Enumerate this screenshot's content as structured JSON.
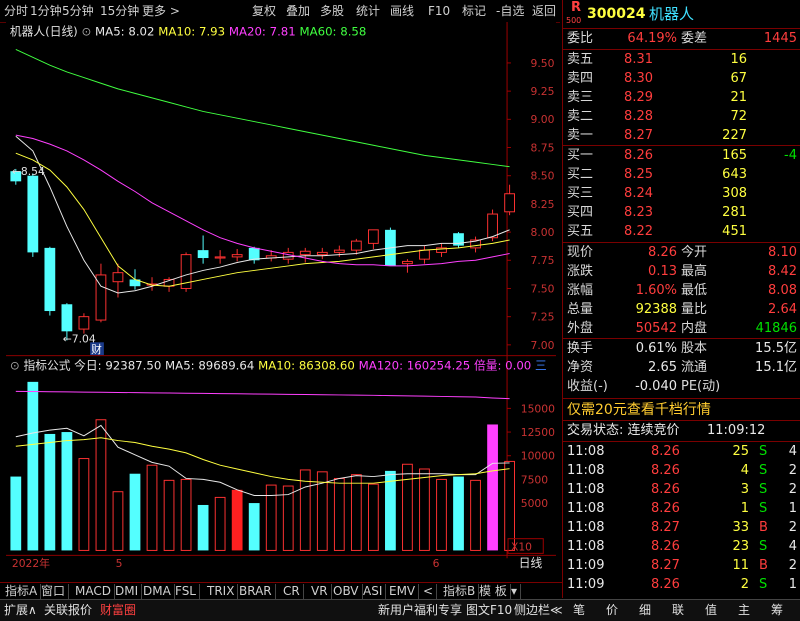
{
  "menu": [
    "分时",
    "1分钟",
    "5分钟",
    "15分钟",
    "更多 >",
    "复权",
    "叠加",
    "多股",
    "统计",
    "画线",
    "F10",
    "标记",
    "-自选",
    "返回"
  ],
  "chart": {
    "title": "机器人(日线)",
    "ma_legend": [
      {
        "label": "MA5: 8.02",
        "color": "#e8e8e8"
      },
      {
        "label": "MA10: 7.93",
        "color": "#ffff40"
      },
      {
        "label": "MA20: 7.81",
        "color": "#ff40ff"
      },
      {
        "label": "MA60: 8.58",
        "color": "#40ff40"
      }
    ],
    "y_ticks": [
      "9.50",
      "9.25",
      "9.00",
      "8.75",
      "8.50",
      "8.25",
      "8.00",
      "7.75",
      "7.50",
      "7.25",
      "7.00"
    ],
    "high_label": "8.54",
    "low_label": "7.04",
    "cai_badge": "财",
    "vol_legend": [
      {
        "label": "指标公式",
        "color": "#e0e0e0"
      },
      {
        "label": "今日: 92387.50",
        "color": "#e8e8e8"
      },
      {
        "label": "MA5: 89689.64",
        "color": "#e8e8e8"
      },
      {
        "label": "MA10: 86308.60",
        "color": "#ffff40"
      },
      {
        "label": "MA120: 160254.25",
        "color": "#ff40ff"
      },
      {
        "label": "倍量: 0.00",
        "color": "#ff40ff"
      },
      {
        "label": "三",
        "color": "#4080ff"
      }
    ],
    "vol_ticks": [
      "15000",
      "12500",
      "10000",
      "7500",
      "5000"
    ],
    "vol_unit": "X10",
    "x_labels": [
      "2022年",
      "5",
      "6"
    ],
    "period": "日线"
  },
  "chart_data": {
    "type": "candlestick",
    "title": "机器人(日线)",
    "price_ylim": [
      6.93,
      9.62
    ],
    "volume_ylim": [
      0,
      18600
    ],
    "candles": [
      {
        "o": 8.54,
        "h": 8.56,
        "l": 8.42,
        "c": 8.45
      },
      {
        "o": 8.5,
        "h": 8.52,
        "l": 7.78,
        "c": 7.82
      },
      {
        "o": 7.86,
        "h": 7.87,
        "l": 7.26,
        "c": 7.3
      },
      {
        "o": 7.36,
        "h": 7.37,
        "l": 7.04,
        "c": 7.12
      },
      {
        "o": 7.14,
        "h": 7.28,
        "l": 7.1,
        "c": 7.25
      },
      {
        "o": 7.22,
        "h": 7.72,
        "l": 7.2,
        "c": 7.62
      },
      {
        "o": 7.56,
        "h": 7.72,
        "l": 7.42,
        "c": 7.64
      },
      {
        "o": 7.58,
        "h": 7.67,
        "l": 7.49,
        "c": 7.52
      },
      {
        "o": 7.53,
        "h": 7.6,
        "l": 7.48,
        "c": 7.54
      },
      {
        "o": 7.52,
        "h": 7.6,
        "l": 7.47,
        "c": 7.58
      },
      {
        "o": 7.5,
        "h": 7.82,
        "l": 7.47,
        "c": 7.8
      },
      {
        "o": 7.84,
        "h": 7.97,
        "l": 7.72,
        "c": 7.77
      },
      {
        "o": 7.77,
        "h": 7.84,
        "l": 7.72,
        "c": 7.78
      },
      {
        "o": 7.78,
        "h": 7.85,
        "l": 7.74,
        "c": 7.8
      },
      {
        "o": 7.86,
        "h": 7.87,
        "l": 7.72,
        "c": 7.75
      },
      {
        "o": 7.77,
        "h": 7.84,
        "l": 7.74,
        "c": 7.79
      },
      {
        "o": 7.76,
        "h": 7.86,
        "l": 7.72,
        "c": 7.82
      },
      {
        "o": 7.8,
        "h": 7.86,
        "l": 7.73,
        "c": 7.83
      },
      {
        "o": 7.8,
        "h": 7.86,
        "l": 7.76,
        "c": 7.82
      },
      {
        "o": 7.82,
        "h": 7.88,
        "l": 7.78,
        "c": 7.84
      },
      {
        "o": 7.84,
        "h": 7.94,
        "l": 7.8,
        "c": 7.92
      },
      {
        "o": 7.9,
        "h": 8.02,
        "l": 7.85,
        "c": 8.02
      },
      {
        "o": 8.02,
        "h": 8.04,
        "l": 7.7,
        "c": 7.7
      },
      {
        "o": 7.72,
        "h": 7.76,
        "l": 7.64,
        "c": 7.74
      },
      {
        "o": 7.76,
        "h": 7.88,
        "l": 7.72,
        "c": 7.84
      },
      {
        "o": 7.82,
        "h": 7.9,
        "l": 7.78,
        "c": 7.86
      },
      {
        "o": 7.99,
        "h": 8.0,
        "l": 7.86,
        "c": 7.88
      },
      {
        "o": 7.86,
        "h": 7.96,
        "l": 7.82,
        "c": 7.93
      },
      {
        "o": 7.95,
        "h": 8.2,
        "l": 7.92,
        "c": 8.16
      },
      {
        "o": 8.18,
        "h": 8.42,
        "l": 8.15,
        "c": 8.34
      }
    ],
    "ma": [
      {
        "name": "MA5",
        "color": "#e8e8e8",
        "values": [
          8.85,
          8.72,
          8.4,
          8.05,
          7.75,
          7.52,
          7.46,
          7.48,
          7.52,
          7.57,
          7.62,
          7.66,
          7.69,
          7.73,
          7.76,
          7.77,
          7.78,
          7.79,
          7.79,
          7.8,
          7.81,
          7.84,
          7.86,
          7.88,
          7.88,
          7.9,
          7.9,
          7.92,
          7.96,
          8.02
        ]
      },
      {
        "name": "MA10",
        "color": "#ffff40",
        "values": [
          8.7,
          8.64,
          8.55,
          8.4,
          8.2,
          7.95,
          7.7,
          7.58,
          7.53,
          7.52,
          7.55,
          7.58,
          7.61,
          7.64,
          7.66,
          7.68,
          7.7,
          7.72,
          7.73,
          7.74,
          7.76,
          7.78,
          7.8,
          7.82,
          7.84,
          7.85,
          7.86,
          7.88,
          7.9,
          7.93
        ]
      },
      {
        "name": "MA20",
        "color": "#ff40ff",
        "values": [
          8.86,
          8.83,
          8.78,
          8.72,
          8.64,
          8.55,
          8.45,
          8.36,
          8.26,
          8.18,
          8.1,
          8.02,
          7.95,
          7.9,
          7.86,
          7.83,
          7.8,
          7.77,
          7.74,
          7.72,
          7.71,
          7.71,
          7.7,
          7.7,
          7.71,
          7.72,
          7.74,
          7.75,
          7.78,
          7.81
        ]
      },
      {
        "name": "MA60",
        "color": "#40ff40",
        "values": [
          9.62,
          9.55,
          9.48,
          9.42,
          9.37,
          9.32,
          9.27,
          9.23,
          9.19,
          9.15,
          9.11,
          9.07,
          9.04,
          9.01,
          8.98,
          8.95,
          8.92,
          8.89,
          8.86,
          8.83,
          8.8,
          8.77,
          8.74,
          8.71,
          8.68,
          8.66,
          8.64,
          8.62,
          8.6,
          8.58
        ]
      }
    ],
    "volume": [
      7800,
      17800,
      12300,
      12500,
      9700,
      13800,
      6200,
      8100,
      9000,
      7400,
      7500,
      4800,
      5600,
      6400,
      5000,
      6900,
      6800,
      8500,
      8300,
      7600,
      8000,
      7000,
      8400,
      9100,
      8600,
      7500,
      7800,
      7400,
      13300,
      9400
    ],
    "volume_ma": [
      {
        "name": "MA5",
        "color": "#e8e8e8",
        "values": [
          12000,
          12400,
          12700,
          12900,
          12100,
          13200,
          10900,
          10100,
          9300,
          8900,
          7600,
          7500,
          7200,
          6400,
          5800,
          5800,
          5900,
          6700,
          7100,
          7600,
          7900,
          7800,
          8000,
          8100,
          8100,
          8100,
          8000,
          8000,
          9200,
          9239
        ]
      },
      {
        "name": "MA10",
        "color": "#ffff40",
        "values": [
          11000,
          11200,
          11400,
          11600,
          11700,
          11900,
          11600,
          11400,
          11000,
          10700,
          10300,
          9600,
          9000,
          8600,
          8200,
          7800,
          7500,
          7300,
          7200,
          7100,
          7100,
          7100,
          7300,
          7500,
          7700,
          7900,
          8000,
          8100,
          8400,
          8631
        ]
      },
      {
        "name": "MA120",
        "color": "#ff40ff",
        "values": [
          16800,
          16780,
          16760,
          16740,
          16720,
          16700,
          16680,
          16660,
          16640,
          16620,
          16600,
          16580,
          16560,
          16540,
          16520,
          16500,
          16480,
          16460,
          16440,
          16420,
          16400,
          16380,
          16350,
          16320,
          16290,
          16260,
          16230,
          16200,
          16100,
          16025
        ]
      }
    ],
    "x_labels": [
      "2022年",
      "5",
      "6"
    ]
  },
  "quote": {
    "logo_top": "R",
    "logo_bottom": "500",
    "code": "300024",
    "name": "机器人",
    "weibi_label": "委比",
    "weibi_value": "64.19%",
    "weicha_label": "委差",
    "weicha_value": "1445",
    "asks": [
      {
        "label": "卖五",
        "price": "8.31",
        "vol": "16",
        "chg": ""
      },
      {
        "label": "卖四",
        "price": "8.30",
        "vol": "67",
        "chg": ""
      },
      {
        "label": "卖三",
        "price": "8.29",
        "vol": "21",
        "chg": ""
      },
      {
        "label": "卖二",
        "price": "8.28",
        "vol": "72",
        "chg": ""
      },
      {
        "label": "卖一",
        "price": "8.27",
        "vol": "227",
        "chg": ""
      }
    ],
    "bids": [
      {
        "label": "买一",
        "price": "8.26",
        "vol": "165",
        "chg": "-4"
      },
      {
        "label": "买二",
        "price": "8.25",
        "vol": "643",
        "chg": ""
      },
      {
        "label": "买三",
        "price": "8.24",
        "vol": "308",
        "chg": ""
      },
      {
        "label": "买四",
        "price": "8.23",
        "vol": "281",
        "chg": ""
      },
      {
        "label": "买五",
        "price": "8.22",
        "vol": "451",
        "chg": ""
      }
    ],
    "stats": [
      {
        "l1": "现价",
        "v1": "8.26",
        "c1": "red",
        "l2": "今开",
        "v2": "8.10",
        "c2": "red"
      },
      {
        "l1": "涨跌",
        "v1": "0.13",
        "c1": "red",
        "l2": "最高",
        "v2": "8.42",
        "c2": "red"
      },
      {
        "l1": "涨幅",
        "v1": "1.60%",
        "c1": "red",
        "l2": "最低",
        "v2": "8.08",
        "c2": "red"
      },
      {
        "l1": "总量",
        "v1": "92388",
        "c1": "yel",
        "l2": "量比",
        "v2": "2.64",
        "c2": "red"
      },
      {
        "l1": "外盘",
        "v1": "50542",
        "c1": "red",
        "l2": "内盘",
        "v2": "41846",
        "c2": "grn"
      }
    ],
    "fund": [
      {
        "l1": "换手",
        "v1": "0.61%",
        "l2": "股本",
        "v2": "15.5亿"
      },
      {
        "l1": "净资",
        "v1": "2.65",
        "l2": "流通",
        "v2": "15.1亿"
      },
      {
        "l1": "收益(-)",
        "v1": "-0.040",
        "l2": "PE(动)",
        "v2": ""
      }
    ],
    "promo": "仅需20元查看千档行情",
    "trade_status_label": "交易状态: 连续竞价",
    "trade_time": "11:09:12",
    "ticks": [
      {
        "t": "11:08",
        "p": "8.26",
        "v": "25",
        "s": "S",
        "n": "4"
      },
      {
        "t": "11:08",
        "p": "8.26",
        "v": "4",
        "s": "S",
        "n": "2"
      },
      {
        "t": "11:08",
        "p": "8.26",
        "v": "3",
        "s": "S",
        "n": "2"
      },
      {
        "t": "11:08",
        "p": "8.26",
        "v": "1",
        "s": "S",
        "n": "1"
      },
      {
        "t": "11:08",
        "p": "8.27",
        "v": "33",
        "s": "B",
        "n": "2"
      },
      {
        "t": "11:08",
        "p": "8.26",
        "v": "23",
        "s": "S",
        "n": "4"
      },
      {
        "t": "11:09",
        "p": "8.27",
        "v": "11",
        "s": "B",
        "n": "2"
      },
      {
        "t": "11:09",
        "p": "8.26",
        "v": "2",
        "s": "S",
        "n": "1"
      }
    ]
  },
  "tabs": [
    "指标A",
    "窗口",
    "MACD",
    "DMI",
    "DMA",
    "FSL",
    "TRIX",
    "BRAR",
    "CR",
    "VR",
    "OBV",
    "ASI",
    "EMV",
    "<",
    "指标B",
    "模 板",
    "▾"
  ],
  "status_left": [
    {
      "label": "扩展∧",
      "color": "#e0e0e0"
    },
    {
      "label": "关联报价",
      "color": "#e0e0e0"
    },
    {
      "label": "财富圈",
      "color": "#ff4040"
    }
  ],
  "status_mid": [
    "新用户福利专享",
    "图文F10",
    "侧边栏≪"
  ],
  "status_right": [
    "笔",
    "价",
    "细",
    "联",
    "值",
    "主",
    "筹"
  ]
}
